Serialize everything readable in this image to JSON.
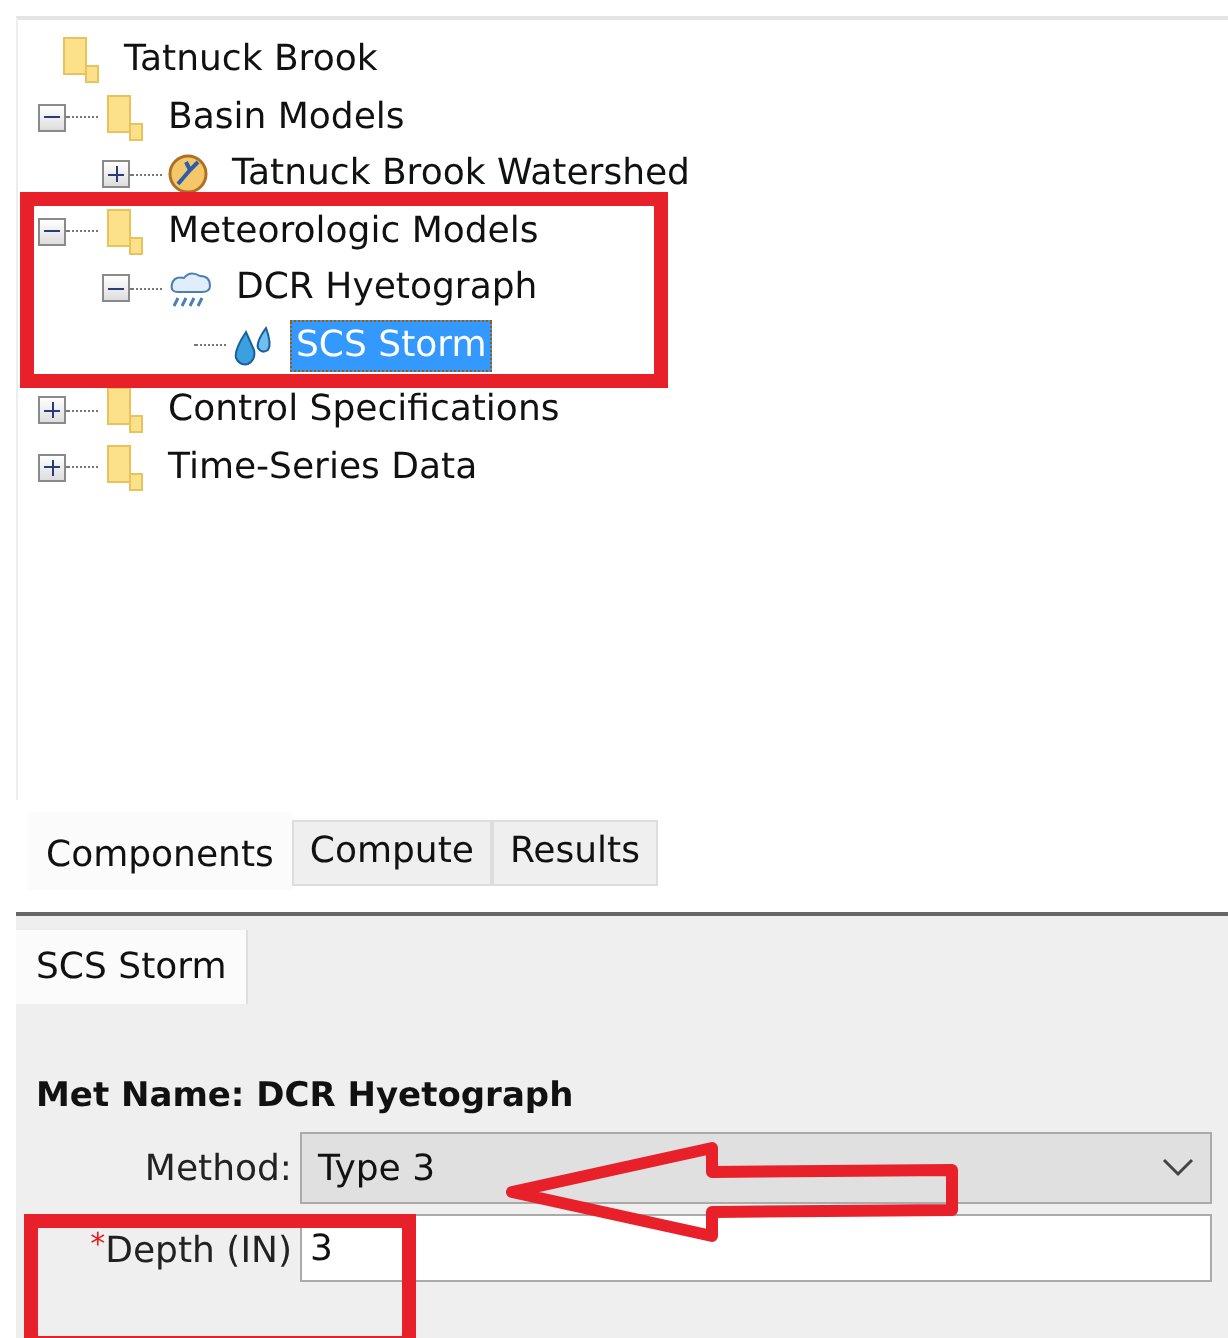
{
  "tree": {
    "label": "Tatnuck Brook",
    "kind": "folder",
    "children": [
      {
        "label": "Basin Models",
        "kind": "folder",
        "expanded": true,
        "selected": false,
        "children": [
          {
            "label": "Tatnuck Brook Watershed",
            "kind": "basin",
            "expanded": false,
            "selected": false
          }
        ]
      },
      {
        "label": "Meteorologic Models",
        "kind": "folder",
        "expanded": true,
        "selected": false,
        "children": [
          {
            "label": "DCR Hyetograph",
            "kind": "weather",
            "expanded": true,
            "selected": false,
            "children": [
              {
                "label": "SCS Storm",
                "kind": "drops",
                "selected": true
              }
            ]
          }
        ]
      },
      {
        "label": "Control Specifications",
        "kind": "folder",
        "expanded": false,
        "selected": false
      },
      {
        "label": "Time-Series Data",
        "kind": "folder",
        "expanded": false,
        "selected": false
      }
    ]
  },
  "tabs": [
    {
      "label": "Components",
      "selected": true
    },
    {
      "label": "Compute",
      "selected": false
    },
    {
      "label": "Results",
      "selected": false
    }
  ],
  "editor": {
    "tab": "SCS Storm",
    "heading": "Met Name: DCR Hyetograph",
    "fields": [
      {
        "kind": "dropdown",
        "label": "Method:",
        "value": "Type 3",
        "required": false
      },
      {
        "kind": "text",
        "label": "Depth (IN)",
        "value": "3",
        "required": true,
        "required_mark": "*"
      }
    ]
  }
}
